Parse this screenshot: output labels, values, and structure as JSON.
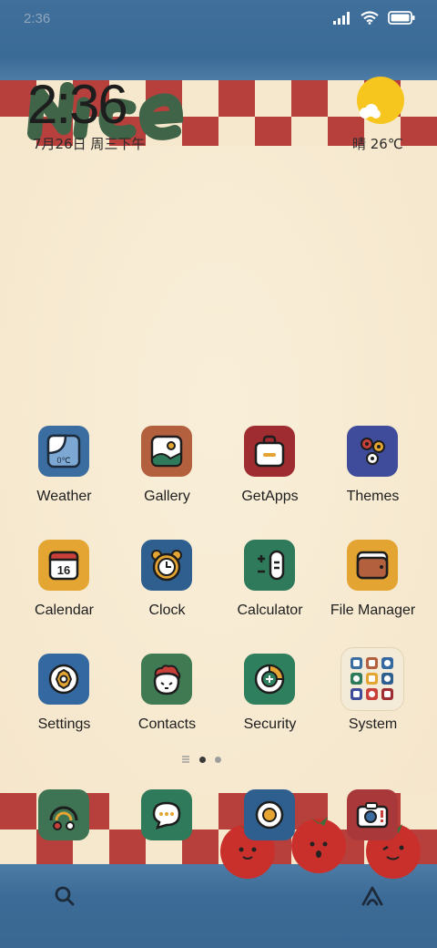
{
  "status_bar": {
    "time": "2:36"
  },
  "widget": {
    "time": "2:36",
    "date": "7月26日 周三下午",
    "weather": "晴 26℃"
  },
  "apps": [
    {
      "id": "weather",
      "label": "Weather",
      "icon": "weather-icon",
      "color": "#3b6da0"
    },
    {
      "id": "gallery",
      "label": "Gallery",
      "icon": "gallery-icon",
      "color": "#b3603f"
    },
    {
      "id": "getapps",
      "label": "GetApps",
      "icon": "bag-icon",
      "color": "#9f2c31"
    },
    {
      "id": "themes",
      "label": "Themes",
      "icon": "flowers-icon",
      "color": "#3f4c9c"
    },
    {
      "id": "calendar",
      "label": "Calendar",
      "icon": "calendar-icon",
      "color": "#e4a532"
    },
    {
      "id": "clock",
      "label": "Clock",
      "icon": "alarm-clock-icon",
      "color": "#2f5f8f"
    },
    {
      "id": "calculator",
      "label": "Calculator",
      "icon": "calculator-icon",
      "color": "#2f7a5b"
    },
    {
      "id": "filemanager",
      "label": "File Manager",
      "icon": "folder-icon",
      "color": "#e3a432"
    },
    {
      "id": "settings",
      "label": "Settings",
      "icon": "gear-icon",
      "color": "#3369a0"
    },
    {
      "id": "contacts",
      "label": "Contacts",
      "icon": "face-icon",
      "color": "#3f7a52"
    },
    {
      "id": "security",
      "label": "Security",
      "icon": "shield-icon",
      "color": "#2e7f5e"
    },
    {
      "id": "system",
      "label": "System",
      "icon": "folder-grid-icon",
      "color": "#f4ead8"
    }
  ],
  "calendar_day": "16",
  "weather_tile_temp": "0℃",
  "dock": [
    {
      "id": "phone",
      "icon": "signal-arcs-icon",
      "color": "#3e7453"
    },
    {
      "id": "messages",
      "icon": "chat-bubble-icon",
      "color": "#2e7a5a"
    },
    {
      "id": "browser",
      "icon": "egg-icon",
      "color": "#2f5f8f"
    },
    {
      "id": "camera",
      "icon": "camera-icon",
      "color": "#a8383a"
    }
  ],
  "page_indicator": {
    "pages": 2,
    "current": 1
  },
  "colors": {
    "red_check": "#b7403d",
    "cream": "#f7ebd3",
    "blue": "#3c6b96"
  }
}
